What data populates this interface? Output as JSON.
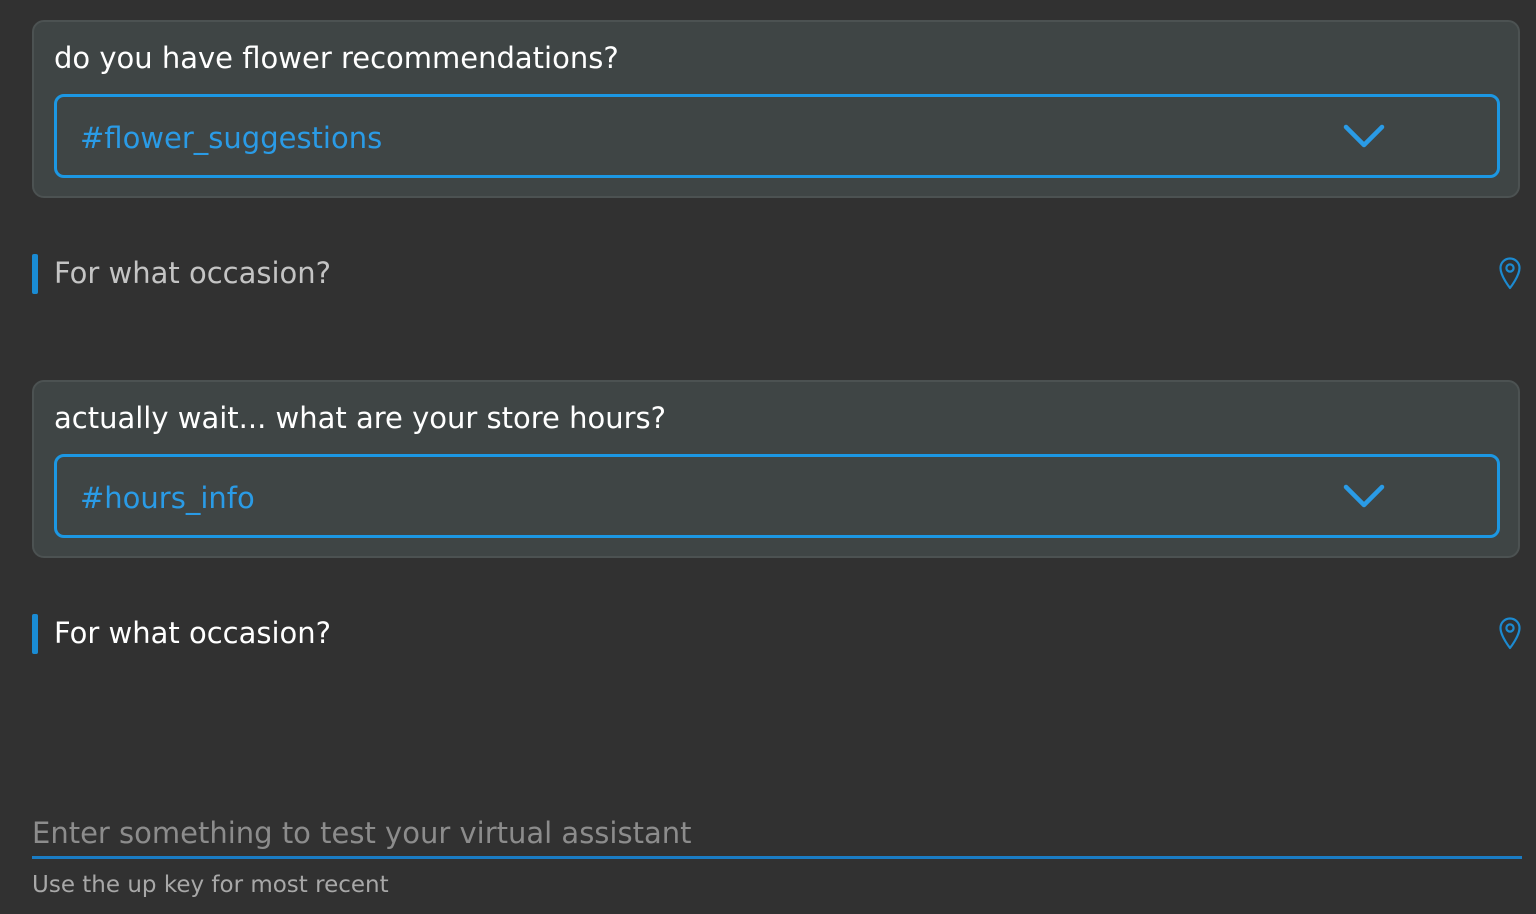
{
  "conversation": [
    {
      "user_message": "do you have flower recommendations?",
      "intent": "#flower_suggestions",
      "bot_reply": "For what occasion?"
    },
    {
      "user_message": "actually wait... what are your store hours?",
      "intent": "#hours_info",
      "bot_reply": "For what occasion?"
    }
  ],
  "input": {
    "placeholder": "Enter something to test your virtual assistant",
    "value": "",
    "helper": "Use the up key for most recent"
  },
  "icons": {
    "dropdown": "chevron-down-icon",
    "locate": "location-pin-icon"
  },
  "colors": {
    "background": "#313131",
    "card": "#3f4545",
    "accent": "#1c97e3"
  }
}
